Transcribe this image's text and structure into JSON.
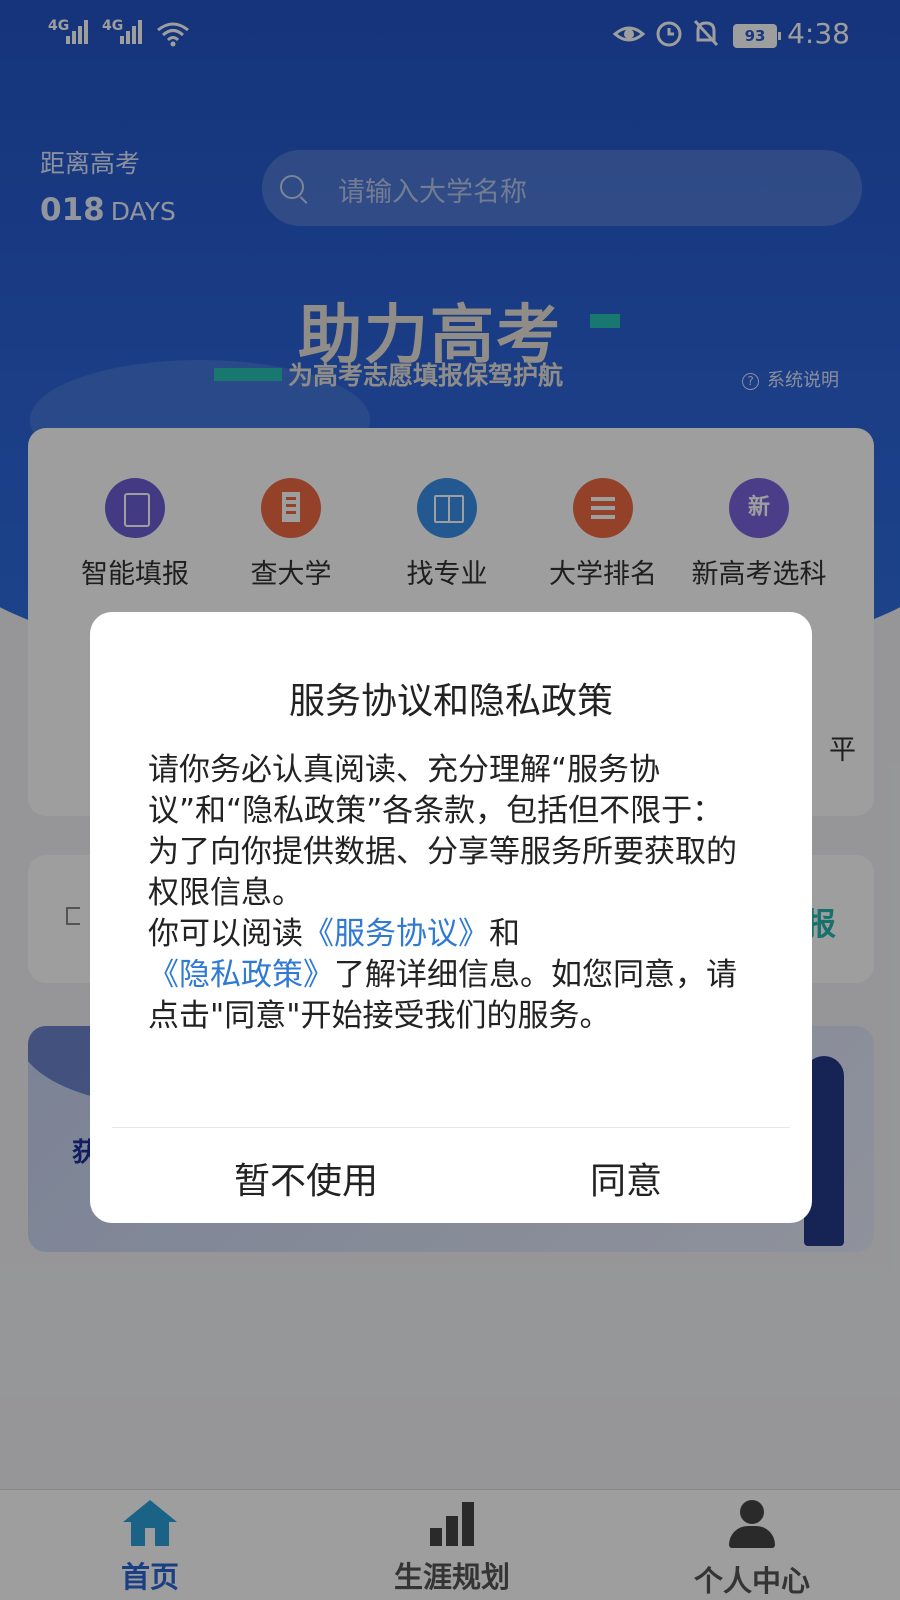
{
  "status_bar": {
    "signal1": "4G",
    "signal2": "4G",
    "battery": "93",
    "time": "4:38"
  },
  "header": {
    "countdown_label": "距离高考",
    "countdown_value": "018",
    "countdown_unit": "DAYS",
    "search_placeholder": "请输入大学名称",
    "slogan_title": "助力高考",
    "slogan_sub": "为高考志愿填报保驾护航",
    "system_help": "系统说明"
  },
  "features": [
    {
      "label": "智能填报",
      "icon": "clipboard-icon",
      "color": "#6c5ed6"
    },
    {
      "label": "查大学",
      "icon": "building-icon",
      "color": "#ef6a45"
    },
    {
      "label": "找专业",
      "icon": "book-icon",
      "color": "#3b8ee9"
    },
    {
      "label": "大学排名",
      "icon": "list-icon",
      "color": "#ef6a45"
    },
    {
      "label": "新高考选科",
      "icon": "new-badge-icon",
      "glyph": "新",
      "color": "#7b63dd"
    }
  ],
  "card_edge_text": "平",
  "notice_tail": "报",
  "banner_text": "获",
  "dialog": {
    "title": "服务协议和隐私政策",
    "para1": "请你务必认真阅读、充分理解“服务协议”和“隐私政策”各条款，包括但不限于：为了向你提供数据、分享等服务所要获取的权限信息。",
    "para2_prefix": "你可以阅读",
    "link_service": "《服务协议》",
    "para2_and": "和",
    "link_privacy": "《隐私政策》",
    "para2_suffix": "了解详细信息。如您同意，请点击\"同意\"开始接受我们的服务。",
    "decline": "暂不使用",
    "agree": "同意"
  },
  "tabbar": {
    "home": "首页",
    "career": "生涯规划",
    "me": "个人中心"
  },
  "colors": {
    "header_blue": "#2a5ccf",
    "accent_teal": "#27c0b4",
    "link_blue": "#2f7ad4",
    "tab_active": "#2b66d6"
  }
}
